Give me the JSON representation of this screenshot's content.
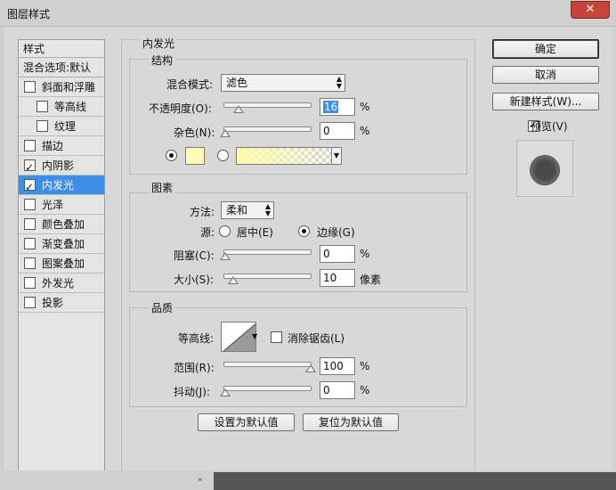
{
  "window": {
    "title": "图层样式",
    "close_glyph": "✕"
  },
  "styles_panel": {
    "header": "样式",
    "blend_options": "混合选项:默认",
    "items": [
      {
        "label": "斜面和浮雕",
        "checked": false,
        "sub": false,
        "active": false
      },
      {
        "label": "等高线",
        "checked": false,
        "sub": true,
        "active": false
      },
      {
        "label": "纹理",
        "checked": false,
        "sub": true,
        "active": false
      },
      {
        "label": "描边",
        "checked": false,
        "sub": false,
        "active": false
      },
      {
        "label": "内阴影",
        "checked": true,
        "sub": false,
        "active": false
      },
      {
        "label": "内发光",
        "checked": true,
        "sub": false,
        "active": true
      },
      {
        "label": "光泽",
        "checked": false,
        "sub": false,
        "active": false
      },
      {
        "label": "颜色叠加",
        "checked": false,
        "sub": false,
        "active": false
      },
      {
        "label": "渐变叠加",
        "checked": false,
        "sub": false,
        "active": false
      },
      {
        "label": "图案叠加",
        "checked": false,
        "sub": false,
        "active": false
      },
      {
        "label": "外发光",
        "checked": false,
        "sub": false,
        "active": false
      },
      {
        "label": "投影",
        "checked": false,
        "sub": false,
        "active": false
      }
    ]
  },
  "inner_glow": {
    "title": "内发光",
    "structure": {
      "title": "结构",
      "blend_mode_label": "混合模式:",
      "blend_mode_value": "滤色",
      "opacity_label": "不透明度(O):",
      "opacity_value": "16",
      "opacity_unit": "%",
      "opacity_fraction": 0.16,
      "noise_label": "杂色(N):",
      "noise_value": "0",
      "noise_unit": "%",
      "glow_color": "#fefcb4"
    },
    "elements": {
      "title": "图素",
      "technique_label": "方法:",
      "technique_value": "柔和",
      "source_label": "源:",
      "source_center": "居中(E)",
      "source_edge": "边缘(G)",
      "choke_label": "阻塞(C):",
      "choke_value": "0",
      "choke_unit": "%",
      "size_label": "大小(S):",
      "size_value": "10",
      "size_unit": "像素"
    },
    "quality": {
      "title": "品质",
      "contour_label": "等高线:",
      "anti_alias_label": "消除锯齿(L)",
      "range_label": "范围(R):",
      "range_value": "100",
      "range_unit": "%",
      "jitter_label": "抖动(J):",
      "jitter_value": "0",
      "jitter_unit": "%"
    },
    "make_default": "设置为默认值",
    "reset_default": "复位为默认值"
  },
  "buttons": {
    "ok": "确定",
    "cancel": "取消",
    "new_style": "新建样式(W)...",
    "preview_label": "预览(V)",
    "preview_checked": true
  }
}
